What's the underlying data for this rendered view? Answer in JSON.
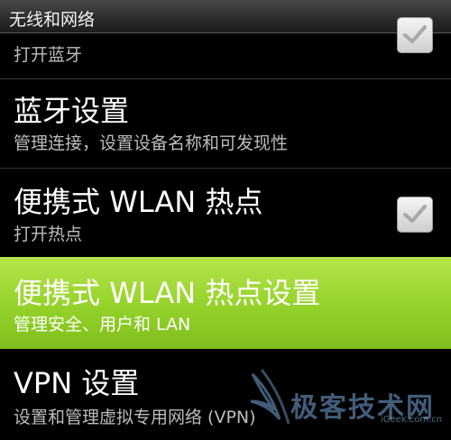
{
  "header": {
    "title": "无线和网络"
  },
  "items": [
    {
      "label": "",
      "summary": "打开蓝牙",
      "checked": true
    },
    {
      "label": "蓝牙设置",
      "summary": "管理连接，设置设备名称和可发现性"
    },
    {
      "label": "便携式 WLAN 热点",
      "summary": "打开热点",
      "checked": true
    },
    {
      "label": "便携式 WLAN 热点设置",
      "summary": "管理安全、用户和 LAN",
      "highlighted": true
    },
    {
      "label": "VPN 设置",
      "summary": "设置和管理虚拟专用网络 (VPN)"
    }
  ],
  "watermark": {
    "text": "极客技术网",
    "url": "iGeek.com.cn"
  },
  "colors": {
    "highlight": "#94d22a",
    "background": "#000000",
    "summary_text": "#bdbdbd"
  }
}
